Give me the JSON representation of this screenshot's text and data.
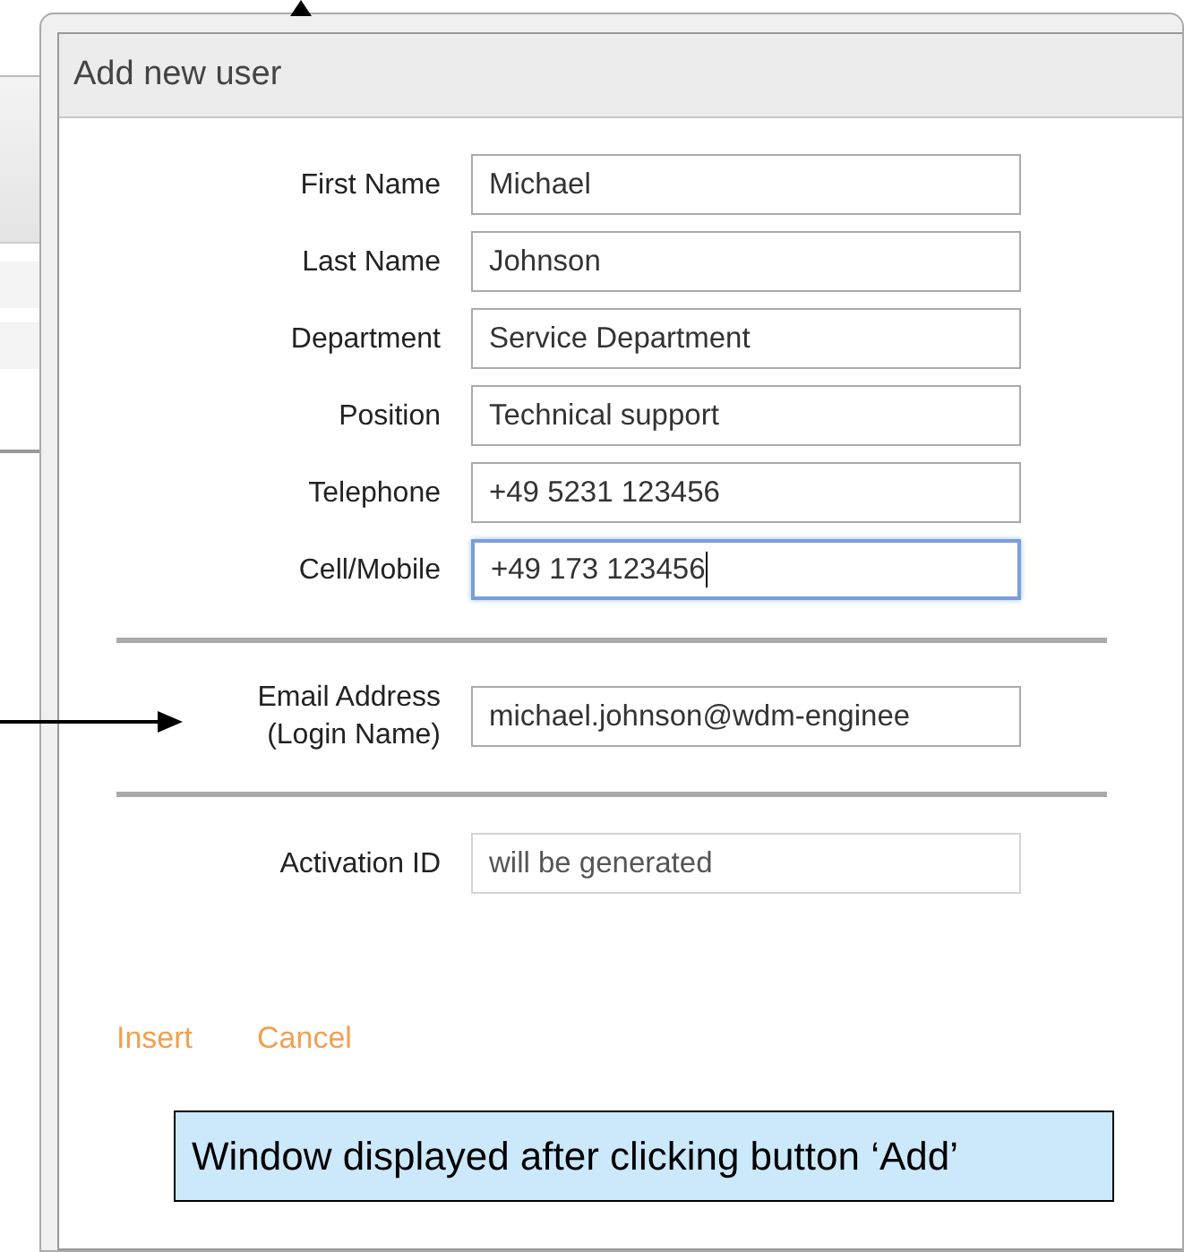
{
  "dialog": {
    "title": "Add new user",
    "sections": [
      {
        "fields": [
          {
            "label": "First Name",
            "value": "Michael",
            "focused": false,
            "disabled": false
          },
          {
            "label": "Last Name",
            "value": "Johnson",
            "focused": false,
            "disabled": false
          },
          {
            "label": "Department",
            "value": "Service Department",
            "focused": false,
            "disabled": false
          },
          {
            "label": "Position",
            "value": "Technical support",
            "focused": false,
            "disabled": false
          },
          {
            "label": "Telephone",
            "value": "+49 5231 123456",
            "focused": false,
            "disabled": false
          },
          {
            "label": "Cell/Mobile",
            "value": "+49 173 123456",
            "focused": true,
            "disabled": false
          }
        ]
      },
      {
        "fields": [
          {
            "label": "Email Address\n(Login Name)",
            "value": "michael.johnson@wdm-enginee",
            "focused": false,
            "disabled": false
          }
        ]
      },
      {
        "fields": [
          {
            "label": "Activation ID",
            "value": "will be generated",
            "focused": false,
            "disabled": true
          }
        ]
      }
    ],
    "actions": [
      {
        "label": "Insert"
      },
      {
        "label": "Cancel"
      }
    ]
  },
  "callout": {
    "text": "Window displayed after clicking button ‘Add’"
  }
}
